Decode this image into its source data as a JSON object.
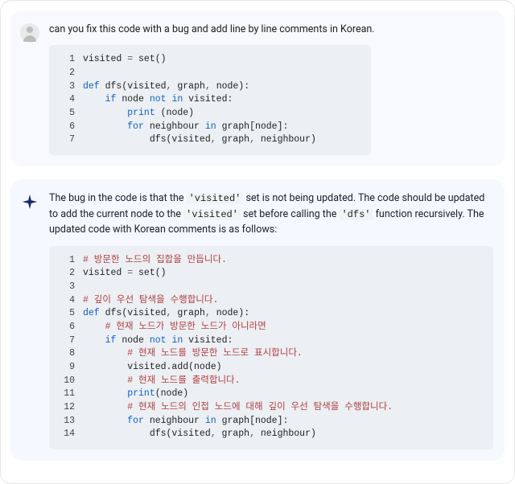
{
  "user": {
    "prompt": "can you fix this code with a bug and add line by line comments in Korean.",
    "code": [
      {
        "n": "1",
        "segs": [
          [
            "id",
            "visited "
          ],
          [
            "op",
            "= "
          ],
          [
            "fn",
            "set"
          ],
          [
            "id",
            "()"
          ]
        ]
      },
      {
        "n": "2",
        "segs": [
          [
            "id",
            ""
          ]
        ]
      },
      {
        "n": "3",
        "segs": [
          [
            "kw",
            "def "
          ],
          [
            "fn",
            "dfs"
          ],
          [
            "id",
            "(visited"
          ],
          [
            "op",
            ", "
          ],
          [
            "id",
            "graph"
          ],
          [
            "op",
            ", "
          ],
          [
            "id",
            "node):"
          ]
        ]
      },
      {
        "n": "4",
        "segs": [
          [
            "id",
            "    "
          ],
          [
            "kw",
            "if "
          ],
          [
            "id",
            "node "
          ],
          [
            "kw",
            "not in "
          ],
          [
            "id",
            "visited:"
          ]
        ]
      },
      {
        "n": "5",
        "segs": [
          [
            "id",
            "        "
          ],
          [
            "kw",
            "print "
          ],
          [
            "id",
            "(node)"
          ]
        ]
      },
      {
        "n": "6",
        "segs": [
          [
            "id",
            "        "
          ],
          [
            "kw",
            "for "
          ],
          [
            "id",
            "neighbour "
          ],
          [
            "kw",
            "in "
          ],
          [
            "id",
            "graph[node]:"
          ]
        ]
      },
      {
        "n": "7",
        "segs": [
          [
            "id",
            "            dfs(visited"
          ],
          [
            "op",
            ", "
          ],
          [
            "id",
            "graph"
          ],
          [
            "op",
            ", "
          ],
          [
            "id",
            "neighbour)"
          ]
        ]
      }
    ]
  },
  "bot": {
    "response_parts": [
      {
        "t": "plain",
        "v": "The bug in the code is that the "
      },
      {
        "t": "mono",
        "v": "'visited'"
      },
      {
        "t": "plain",
        "v": " set is not being updated. The code should be updated to add the current node to the "
      },
      {
        "t": "mono",
        "v": "'visited'"
      },
      {
        "t": "plain",
        "v": " set before calling the "
      },
      {
        "t": "mono",
        "v": "'dfs'"
      },
      {
        "t": "plain",
        "v": " function recursively. The updated code with Korean comments is as follows:"
      }
    ],
    "code": [
      {
        "n": "1",
        "segs": [
          [
            "cm",
            "# 방문한 노드의 집합을 만듭니다."
          ]
        ]
      },
      {
        "n": "2",
        "segs": [
          [
            "id",
            "visited "
          ],
          [
            "op",
            "= "
          ],
          [
            "fn",
            "set"
          ],
          [
            "id",
            "()"
          ]
        ]
      },
      {
        "n": "3",
        "segs": [
          [
            "id",
            ""
          ]
        ]
      },
      {
        "n": "4",
        "segs": [
          [
            "cm",
            "# 깊이 우선 탐색을 수행합니다."
          ]
        ]
      },
      {
        "n": "5",
        "segs": [
          [
            "kw",
            "def "
          ],
          [
            "fn",
            "dfs"
          ],
          [
            "id",
            "(visited"
          ],
          [
            "op",
            ", "
          ],
          [
            "id",
            "graph"
          ],
          [
            "op",
            ", "
          ],
          [
            "id",
            "node):"
          ]
        ]
      },
      {
        "n": "6",
        "segs": [
          [
            "id",
            "    "
          ],
          [
            "cm",
            "# 현재 노드가 방문한 노드가 아니라면"
          ]
        ]
      },
      {
        "n": "7",
        "segs": [
          [
            "id",
            "    "
          ],
          [
            "kw",
            "if "
          ],
          [
            "id",
            "node "
          ],
          [
            "kw",
            "not in "
          ],
          [
            "id",
            "visited:"
          ]
        ]
      },
      {
        "n": "8",
        "segs": [
          [
            "id",
            "        "
          ],
          [
            "cm",
            "# 현재 노드를 방문한 노드로 표시합니다."
          ]
        ]
      },
      {
        "n": "9",
        "segs": [
          [
            "id",
            "        visited.add(node)"
          ]
        ]
      },
      {
        "n": "10",
        "segs": [
          [
            "id",
            "        "
          ],
          [
            "cm",
            "# 현재 노드를 출력합니다."
          ]
        ]
      },
      {
        "n": "11",
        "segs": [
          [
            "id",
            "        "
          ],
          [
            "kw",
            "print"
          ],
          [
            "id",
            "(node)"
          ]
        ]
      },
      {
        "n": "12",
        "segs": [
          [
            "id",
            "        "
          ],
          [
            "cm",
            "# 현재 노드의 인접 노드에 대해 깊이 우선 탐색을 수행합니다."
          ]
        ]
      },
      {
        "n": "13",
        "segs": [
          [
            "id",
            "        "
          ],
          [
            "kw",
            "for "
          ],
          [
            "id",
            "neighbour "
          ],
          [
            "kw",
            "in "
          ],
          [
            "id",
            "graph[node]:"
          ]
        ]
      },
      {
        "n": "14",
        "segs": [
          [
            "id",
            "            dfs(visited"
          ],
          [
            "op",
            ", "
          ],
          [
            "id",
            "graph"
          ],
          [
            "op",
            ", "
          ],
          [
            "id",
            "neighbour)"
          ]
        ]
      }
    ]
  }
}
